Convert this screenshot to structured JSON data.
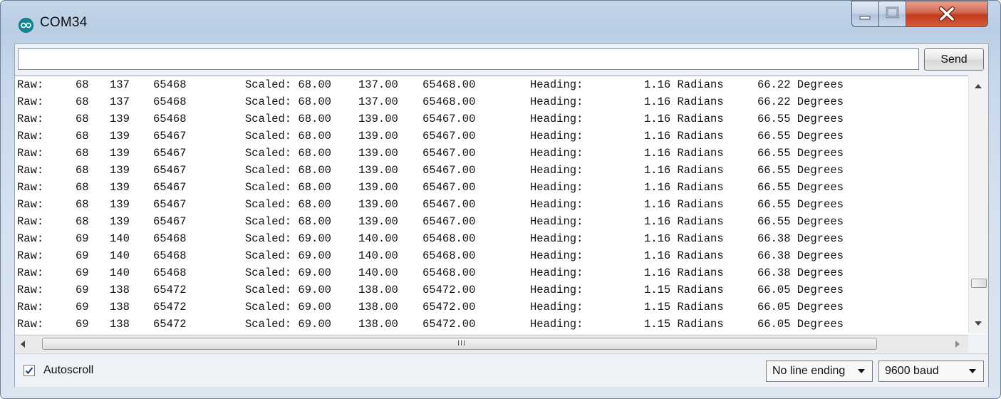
{
  "window": {
    "title": "COM34"
  },
  "toolbar": {
    "send_label": "Send",
    "input_value": ""
  },
  "output": {
    "rows": [
      {
        "raw": "Raw:",
        "x": "68",
        "y": "137",
        "z": "65468",
        "scaled": "Scaled: 68.00",
        "sy": "137.00",
        "sz": "65468.00",
        "heading": "Heading:",
        "rad": "1.16 Radians",
        "deg": "66.22 Degrees"
      },
      {
        "raw": "Raw:",
        "x": "68",
        "y": "137",
        "z": "65468",
        "scaled": "Scaled: 68.00",
        "sy": "137.00",
        "sz": "65468.00",
        "heading": "Heading:",
        "rad": "1.16 Radians",
        "deg": "66.22 Degrees"
      },
      {
        "raw": "Raw:",
        "x": "68",
        "y": "139",
        "z": "65468",
        "scaled": "Scaled: 68.00",
        "sy": "139.00",
        "sz": "65467.00",
        "heading": "Heading:",
        "rad": "1.16 Radians",
        "deg": "66.55 Degrees"
      },
      {
        "raw": "Raw:",
        "x": "68",
        "y": "139",
        "z": "65467",
        "scaled": "Scaled: 68.00",
        "sy": "139.00",
        "sz": "65467.00",
        "heading": "Heading:",
        "rad": "1.16 Radians",
        "deg": "66.55 Degrees"
      },
      {
        "raw": "Raw:",
        "x": "68",
        "y": "139",
        "z": "65467",
        "scaled": "Scaled: 68.00",
        "sy": "139.00",
        "sz": "65467.00",
        "heading": "Heading:",
        "rad": "1.16 Radians",
        "deg": "66.55 Degrees"
      },
      {
        "raw": "Raw:",
        "x": "68",
        "y": "139",
        "z": "65467",
        "scaled": "Scaled: 68.00",
        "sy": "139.00",
        "sz": "65467.00",
        "heading": "Heading:",
        "rad": "1.16 Radians",
        "deg": "66.55 Degrees"
      },
      {
        "raw": "Raw:",
        "x": "68",
        "y": "139",
        "z": "65467",
        "scaled": "Scaled: 68.00",
        "sy": "139.00",
        "sz": "65467.00",
        "heading": "Heading:",
        "rad": "1.16 Radians",
        "deg": "66.55 Degrees"
      },
      {
        "raw": "Raw:",
        "x": "68",
        "y": "139",
        "z": "65467",
        "scaled": "Scaled: 68.00",
        "sy": "139.00",
        "sz": "65467.00",
        "heading": "Heading:",
        "rad": "1.16 Radians",
        "deg": "66.55 Degrees"
      },
      {
        "raw": "Raw:",
        "x": "68",
        "y": "139",
        "z": "65467",
        "scaled": "Scaled: 68.00",
        "sy": "139.00",
        "sz": "65467.00",
        "heading": "Heading:",
        "rad": "1.16 Radians",
        "deg": "66.55 Degrees"
      },
      {
        "raw": "Raw:",
        "x": "69",
        "y": "140",
        "z": "65468",
        "scaled": "Scaled: 69.00",
        "sy": "140.00",
        "sz": "65468.00",
        "heading": "Heading:",
        "rad": "1.16 Radians",
        "deg": "66.38 Degrees"
      },
      {
        "raw": "Raw:",
        "x": "69",
        "y": "140",
        "z": "65468",
        "scaled": "Scaled: 69.00",
        "sy": "140.00",
        "sz": "65468.00",
        "heading": "Heading:",
        "rad": "1.16 Radians",
        "deg": "66.38 Degrees"
      },
      {
        "raw": "Raw:",
        "x": "69",
        "y": "140",
        "z": "65468",
        "scaled": "Scaled: 69.00",
        "sy": "140.00",
        "sz": "65468.00",
        "heading": "Heading:",
        "rad": "1.16 Radians",
        "deg": "66.38 Degrees"
      },
      {
        "raw": "Raw:",
        "x": "69",
        "y": "138",
        "z": "65472",
        "scaled": "Scaled: 69.00",
        "sy": "138.00",
        "sz": "65472.00",
        "heading": "Heading:",
        "rad": "1.15 Radians",
        "deg": "66.05 Degrees"
      },
      {
        "raw": "Raw:",
        "x": "69",
        "y": "138",
        "z": "65472",
        "scaled": "Scaled: 69.00",
        "sy": "138.00",
        "sz": "65472.00",
        "heading": "Heading:",
        "rad": "1.15 Radians",
        "deg": "66.05 Degrees"
      },
      {
        "raw": "Raw:",
        "x": "69",
        "y": "138",
        "z": "65472",
        "scaled": "Scaled: 69.00",
        "sy": "138.00",
        "sz": "65472.00",
        "heading": "Heading:",
        "rad": "1.15 Radians",
        "deg": "66.05 Degrees"
      }
    ]
  },
  "hscroll": {
    "grip": "III"
  },
  "footer": {
    "autoscroll_label": "Autoscroll",
    "autoscroll_checked": true,
    "line_ending_selected": "No line ending",
    "baud_selected": "9600 baud"
  },
  "icons": {
    "app": "arduino-icon",
    "minimize": "minimize-icon",
    "maximize": "maximize-icon",
    "close": "close-icon"
  },
  "colors": {
    "close_button": "#c9462b",
    "app_icon": "#0e8a96"
  }
}
